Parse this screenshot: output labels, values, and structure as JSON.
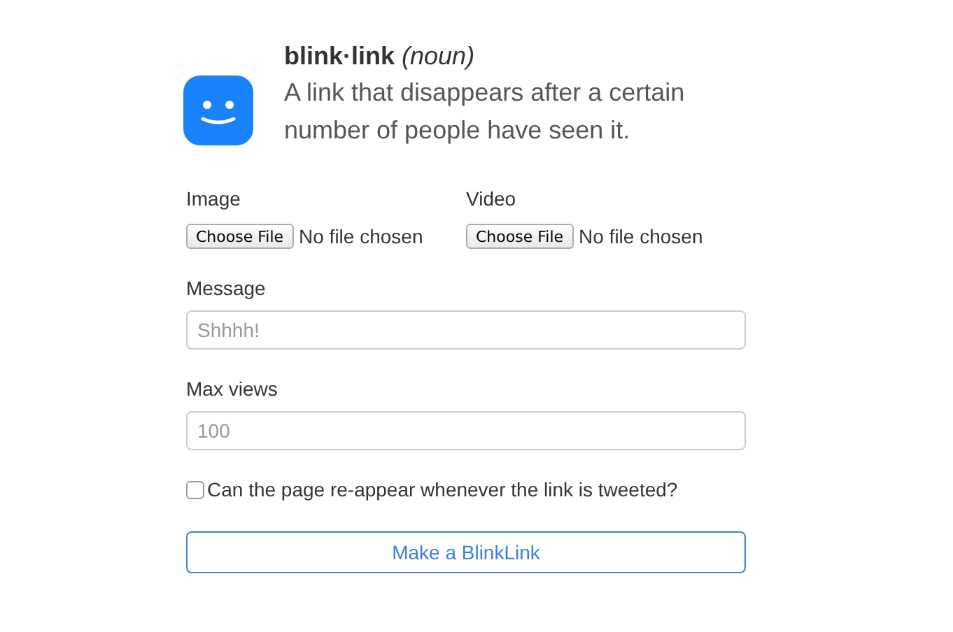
{
  "header": {
    "term": "**blink·link** *(noun)*",
    "definition": "A link that disappears after a certain number of people have seen it."
  },
  "uploads": [
    {
      "label": "Image",
      "button": "Choose File",
      "status": "No file chosen"
    },
    {
      "label": "Video",
      "button": "Choose File",
      "status": "No file chosen"
    }
  ],
  "fields": [
    {
      "label": "Message",
      "placeholder": "Shhhh!"
    },
    {
      "label": "Max views",
      "placeholder": "100"
    }
  ],
  "checkbox": {
    "label": "Can the page re-appear whenever the link is tweeted?",
    "checked": false
  },
  "submit": "Make a BlinkLink"
}
